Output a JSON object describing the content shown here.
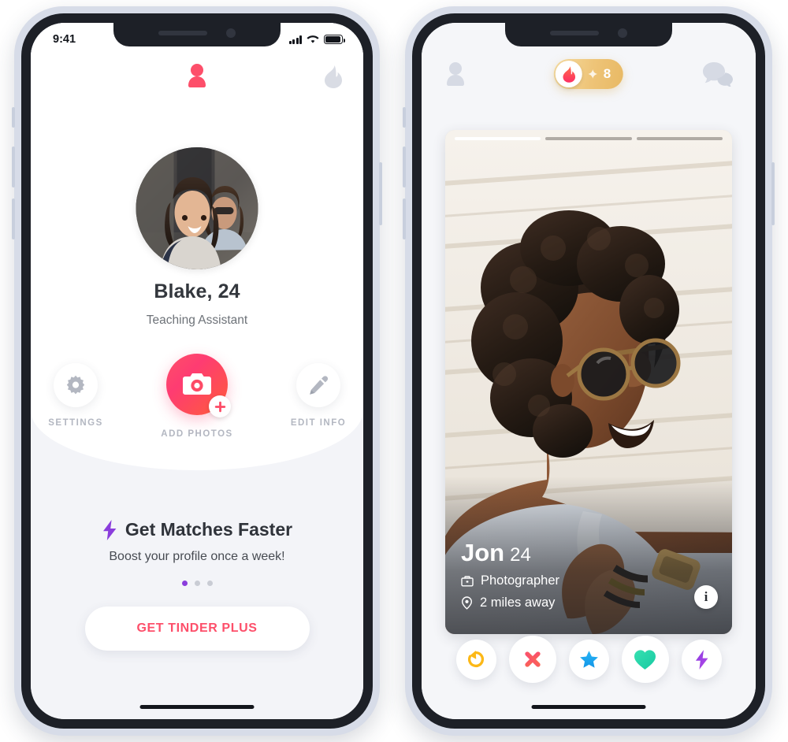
{
  "left_phone": {
    "status_bar": {
      "time": "9:41",
      "signal_icon": "cellular-bars-icon",
      "wifi_icon": "wifi-icon",
      "battery_icon": "battery-full-icon"
    },
    "top_bar": {
      "profile_icon": "person-icon",
      "flame_icon": "flame-icon"
    },
    "profile": {
      "avatar_name": "profile-avatar",
      "name": "Blake, 24",
      "occupation": "Teaching Assistant"
    },
    "actions": [
      {
        "label": "SETTINGS",
        "icon": "gear-icon"
      },
      {
        "label": "ADD PHOTOS",
        "icon": "camera-icon",
        "badge_icon": "plus-icon"
      },
      {
        "label": "EDIT INFO",
        "icon": "pencil-icon"
      }
    ],
    "promo": {
      "icon": "lightning-bolt-icon",
      "title": "Get Matches Faster",
      "subtitle": "Boost your profile once a week!",
      "dots_total": 3,
      "dots_active_index": 0,
      "cta_label": "GET TINDER PLUS"
    }
  },
  "right_phone": {
    "top_bar": {
      "profile_icon": "person-icon",
      "messages_icon": "chat-bubbles-icon",
      "gold_badge": {
        "flame_icon": "flame-icon",
        "sparkle_icon": "sparkle-icon",
        "count": "8"
      }
    },
    "card": {
      "photo_name": "match-photo",
      "segments_total": 3,
      "segments_active_index": 0,
      "name": "Jon",
      "age": "24",
      "occupation": "Photographer",
      "occupation_icon": "briefcase-icon",
      "distance": "2 miles away",
      "distance_icon": "location-pin-icon",
      "info_button_label": "i"
    },
    "actions": [
      {
        "name": "rewind-button",
        "icon": "rewind-arrow-icon",
        "color": "#fcb817",
        "size": "sm"
      },
      {
        "name": "nope-button",
        "icon": "x-cross-icon",
        "color": "#f8566d",
        "size": "md"
      },
      {
        "name": "superlike-button",
        "icon": "star-icon",
        "color": "#1fb7f0",
        "size": "sm"
      },
      {
        "name": "like-button",
        "icon": "heart-icon",
        "color": "#22d9ad",
        "size": "md"
      },
      {
        "name": "boost-button",
        "icon": "lightning-bolt-icon",
        "color": "#9b30e0",
        "size": "sm"
      }
    ]
  },
  "colors": {
    "tinder_pink": "#fd4f6a",
    "tinder_gradient_start": "#fd5068",
    "tinder_gradient_end": "#ff5c39",
    "boost_purple": "#8a3ddc",
    "gold": "#e8b964",
    "screen_gray": "#f3f4f8"
  }
}
